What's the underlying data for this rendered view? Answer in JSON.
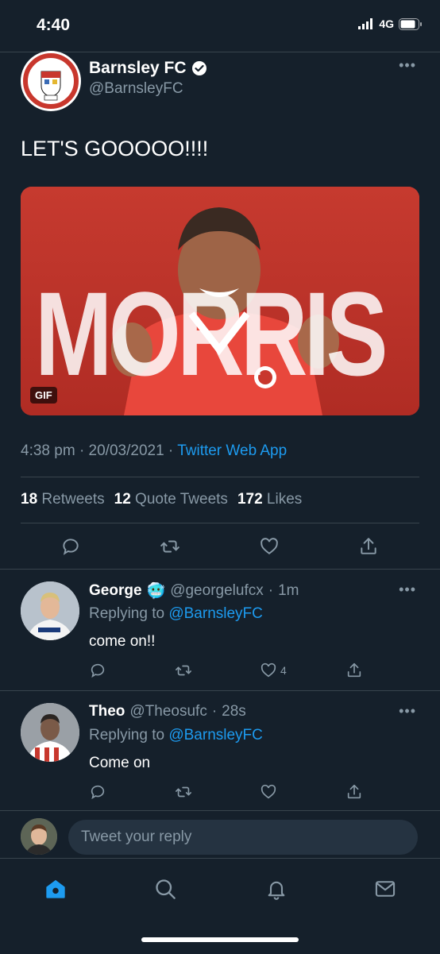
{
  "status_bar": {
    "time": "4:40",
    "network": "4G"
  },
  "tweet": {
    "author_name": "Barnsley FC",
    "author_handle": "@BarnsleyFC",
    "avatar_text": "BARNSLEY FC",
    "avatar_year": "1887",
    "text": "LET'S GOOOOO!!!!",
    "media_text": "MORRIS",
    "media_badge": "GIF",
    "time": "4:38 pm",
    "date": "20/03/2021",
    "source": "Twitter Web App",
    "retweets_count": "18",
    "retweets_label": "Retweets",
    "quotes_count": "12",
    "quotes_label": "Quote Tweets",
    "likes_count": "172",
    "likes_label": "Likes"
  },
  "replies": [
    {
      "name": "George",
      "emoji": "🥶",
      "handle": "@georgelufcx",
      "time": "1m",
      "replying_prefix": "Replying to",
      "replying_to": "@BarnsleyFC",
      "text": "come on!!",
      "likes": "4"
    },
    {
      "name": "Theo",
      "handle": "@Theosufc",
      "time": "28s",
      "replying_prefix": "Replying to",
      "replying_to": "@BarnsleyFC",
      "text": "Come on",
      "likes": ""
    }
  ],
  "composer": {
    "placeholder": "Tweet your reply"
  },
  "colors": {
    "background": "#15202b",
    "accent": "#1d9bf0",
    "muted": "#8899a6",
    "divider": "#38444d"
  }
}
